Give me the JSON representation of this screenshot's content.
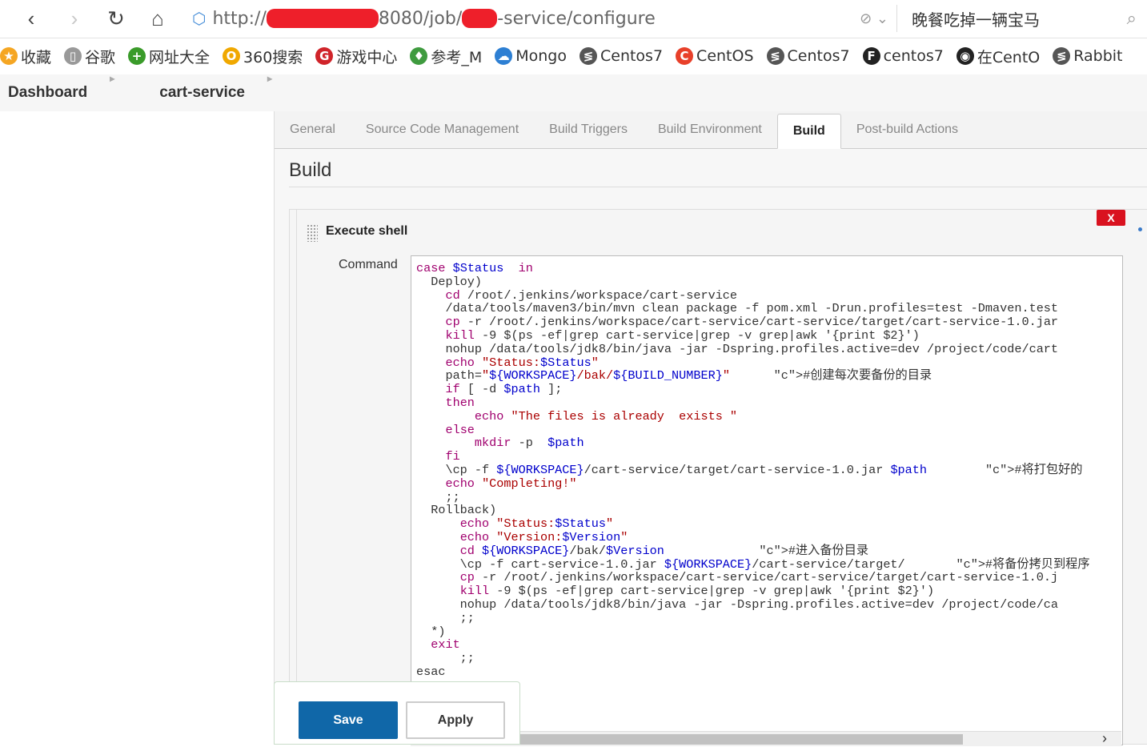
{
  "browser": {
    "address_prefix": "http://",
    "address_mid": "8080/job/",
    "address_suffix": "-service/configure",
    "search_text": "晚餐吃掉一辆宝马",
    "back_icon": "‹",
    "forward_icon": "›",
    "reload_icon": "↻",
    "home_icon": "⌂",
    "search_icon": "⌕"
  },
  "bookmarks": [
    {
      "label": "收藏",
      "icon": "★",
      "color": "#f5a623"
    },
    {
      "label": "谷歌",
      "icon": "▯",
      "color": "#999999"
    },
    {
      "label": "网址大全",
      "icon": "+",
      "color": "#3a9b2a"
    },
    {
      "label": "360搜索",
      "icon": "O",
      "color": "#f0a800"
    },
    {
      "label": "游戏中心",
      "icon": "G",
      "color": "#d0242a"
    },
    {
      "label": "参考_M",
      "icon": "♦",
      "color": "#3f9b3f"
    },
    {
      "label": "Mongo",
      "icon": "☁",
      "color": "#2d7fd3"
    },
    {
      "label": "Centos7",
      "icon": "≶",
      "color": "#555555"
    },
    {
      "label": "CentOS",
      "icon": "C",
      "color": "#e8402a"
    },
    {
      "label": "Centos7",
      "icon": "≶",
      "color": "#555555"
    },
    {
      "label": "centos7",
      "icon": "F",
      "color": "#222222"
    },
    {
      "label": "在CentO",
      "icon": "◉",
      "color": "#222222"
    },
    {
      "label": "Rabbit",
      "icon": "≶",
      "color": "#555555"
    }
  ],
  "breadcrumb": {
    "items": [
      "Dashboard",
      "cart-service"
    ],
    "separator": "▸"
  },
  "tabs": [
    "General",
    "Source Code Management",
    "Build Triggers",
    "Build Environment",
    "Build",
    "Post-build Actions"
  ],
  "active_tab": "Build",
  "section": {
    "title": "Build",
    "step_title": "Execute shell",
    "delete_label": "X",
    "command_label": "Command"
  },
  "command_lines": [
    "case $Status  in",
    "  Deploy)",
    "    cd /root/.jenkins/workspace/cart-service",
    "    /data/tools/maven3/bin/mvn clean package -f pom.xml -Drun.profiles=test -Dmaven.test",
    "    cp -r /root/.jenkins/workspace/cart-service/cart-service/target/cart-service-1.0.jar",
    "    kill -9 $(ps -ef|grep cart-service|grep -v grep|awk '{print $2}')",
    "    nohup /data/tools/jdk8/bin/java -jar -Dspring.profiles.active=dev /project/code/cart",
    "    echo \"Status:$Status\"",
    "    path=\"${WORKSPACE}/bak/${BUILD_NUMBER}\"      #创建每次要备份的目录",
    "    if [ -d $path ];",
    "    then",
    "        echo \"The files is already  exists \"",
    "    else",
    "        mkdir -p  $path",
    "    fi",
    "    \\cp -f ${WORKSPACE}/cart-service/target/cart-service-1.0.jar $path        #将打包好的",
    "    echo \"Completing!\"",
    "    ;;",
    "  Rollback)",
    "      echo \"Status:$Status\"",
    "      echo \"Version:$Version\"",
    "      cd ${WORKSPACE}/bak/$Version             #进入备份目录",
    "      \\cp -f cart-service-1.0.jar ${WORKSPACE}/cart-service/target/       #将备份拷贝到程序",
    "      cp -r /root/.jenkins/workspace/cart-service/cart-service/target/cart-service-1.0.j",
    "      kill -9 $(ps -ef|grep cart-service|grep -v grep|awk '{print $2}')",
    "      nohup /data/tools/jdk8/bin/java -jar -Dspring.profiles.active=dev /project/code/ca",
    "      ;;",
    "  *)",
    "  exit",
    "      ;;",
    "esac"
  ],
  "buttons": {
    "save": "Save",
    "apply": "Apply"
  }
}
